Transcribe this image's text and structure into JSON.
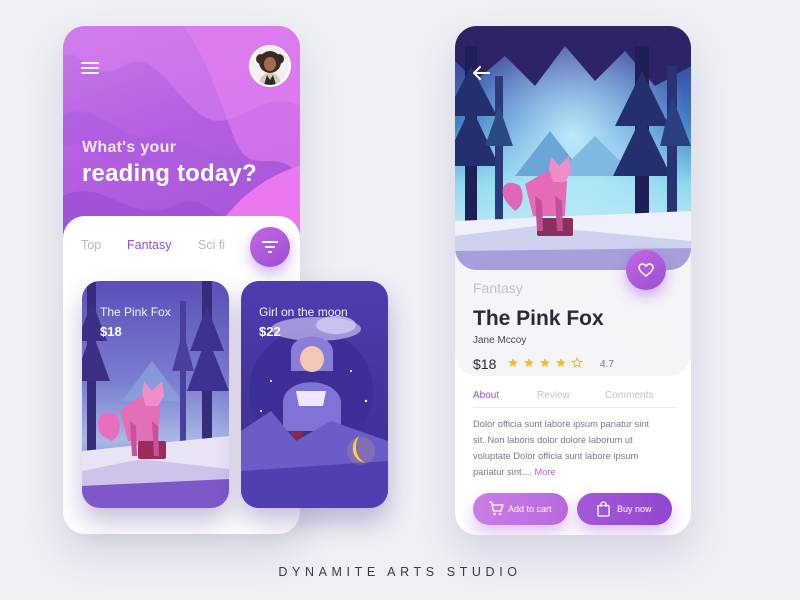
{
  "colors": {
    "accent": "#9b4fd3",
    "accent_light": "#c266e6",
    "star": "#f5b82e",
    "background": "#eef0f5"
  },
  "home": {
    "menu_icon": "hamburger-menu-icon",
    "greeting_line1": "What's your",
    "greeting_line2": "reading today?",
    "tabs": [
      {
        "label": "Top",
        "active": false
      },
      {
        "label": "Fantasy",
        "active": true
      },
      {
        "label": "Sci fi",
        "active": false
      }
    ],
    "filter_icon": "filter-icon",
    "books": [
      {
        "title": "The Pink Fox",
        "price": "$18"
      },
      {
        "title": "Girl on the moon",
        "price": "$22"
      }
    ]
  },
  "detail": {
    "back_icon": "back-arrow-icon",
    "favorite_icon": "heart-icon",
    "genre": "Fantasy",
    "title": "The Pink Fox",
    "author": "Jane Mccoy",
    "price": "$18",
    "stars_filled": 4,
    "stars_total": 5,
    "rating": "4.7",
    "tabs": [
      {
        "label": "About",
        "active": true
      },
      {
        "label": "Review",
        "active": false
      },
      {
        "label": "Comments",
        "active": false
      }
    ],
    "description": "Dolor officia sunt labore ipsum pariatur sint sit. Non laboris dolor dolore laborum ut voluptate  Dolor officia sunt labore ipsum pariatur sint....",
    "more_label": "More",
    "add_to_cart_label": "Add to cart",
    "buy_now_label": "Buy now"
  },
  "footer": {
    "studio": "DYNAMITE ARTS STUDIO"
  }
}
